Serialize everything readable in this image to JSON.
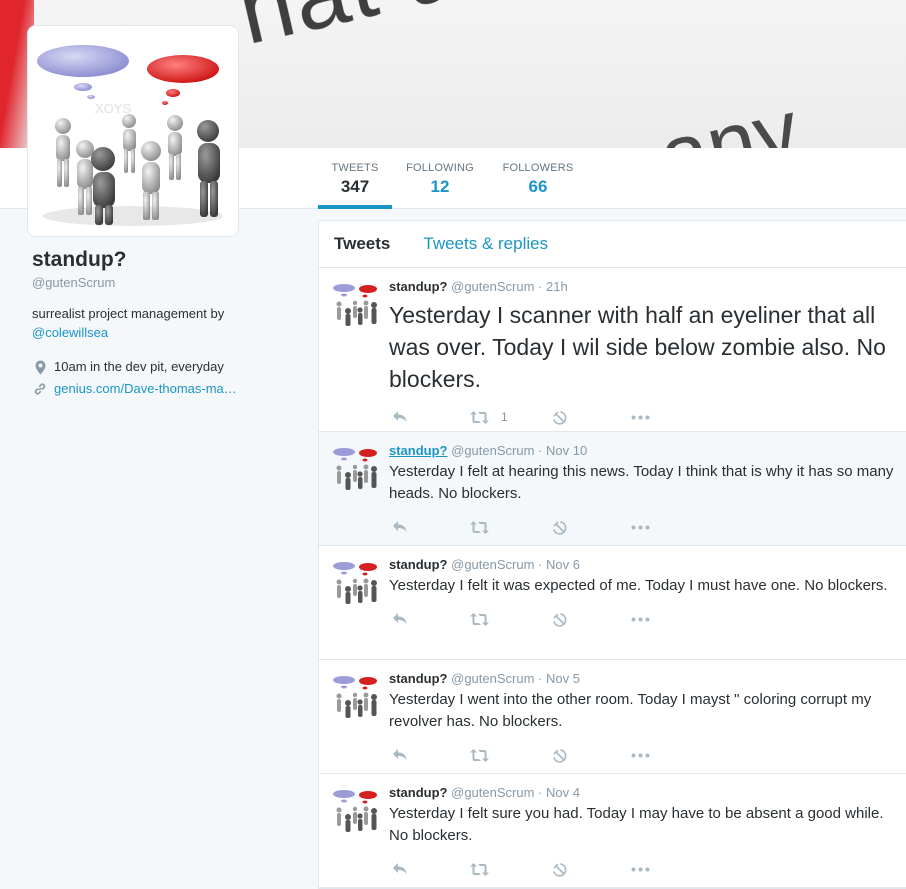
{
  "banner": {
    "text": "hat are you do",
    "text2": "any"
  },
  "stats": [
    {
      "label": "TWEETS",
      "value": "347"
    },
    {
      "label": "FOLLOWING",
      "value": "12"
    },
    {
      "label": "FOLLOWERS",
      "value": "66"
    }
  ],
  "profile": {
    "name": "standup?",
    "handle": "@gutenScrum",
    "bio": "surrealist project management by",
    "bio_link": "@colewillsea",
    "location": "10am in the dev pit, everyday",
    "url": "genius.com/Dave-thomas-ma…"
  },
  "tabs": {
    "tweets": "Tweets",
    "replies": "Tweets & replies"
  },
  "tweets": [
    {
      "name": "standup?",
      "handle": "@gutenScrum",
      "time": "· 21h",
      "text": "Yesterday I scanner with half an eyeliner that all was over. Today I wil side below zombie also. No blockers.",
      "retweets": "1"
    },
    {
      "name": "standup?",
      "handle": "@gutenScrum",
      "time": "· Nov 10",
      "text": "Yesterday I felt at hearing this news. Today I think that is why it has so many heads. No blockers.",
      "retweets": ""
    },
    {
      "name": "standup?",
      "handle": "@gutenScrum",
      "time": "· Nov 6",
      "text": "Yesterday I felt it was expected of me. Today I must have one. No blockers.",
      "retweets": ""
    },
    {
      "name": "standup?",
      "handle": "@gutenScrum",
      "time": "· Nov 5",
      "text": "Yesterday I went into the other room. Today I mayst \" coloring corrupt my revolver has. No blockers.",
      "retweets": ""
    },
    {
      "name": "standup?",
      "handle": "@gutenScrum",
      "time": "· Nov 4",
      "text": "Yesterday I felt sure you had. Today I may have to be absent a good while. No blockers.",
      "retweets": ""
    }
  ],
  "colors": {
    "accent": "#1b95c6",
    "text": "#292f33",
    "muted": "#8899a6"
  }
}
